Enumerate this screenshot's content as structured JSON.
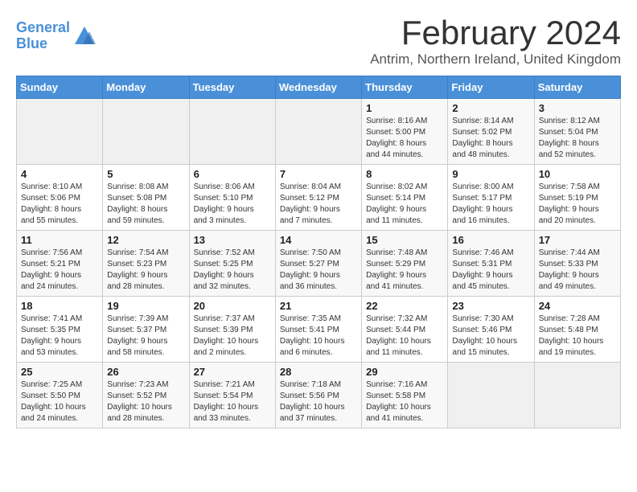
{
  "header": {
    "logo_line1": "General",
    "logo_line2": "Blue",
    "month_year": "February 2024",
    "location": "Antrim, Northern Ireland, United Kingdom"
  },
  "days_of_week": [
    "Sunday",
    "Monday",
    "Tuesday",
    "Wednesday",
    "Thursday",
    "Friday",
    "Saturday"
  ],
  "weeks": [
    [
      {
        "day": "",
        "info": ""
      },
      {
        "day": "",
        "info": ""
      },
      {
        "day": "",
        "info": ""
      },
      {
        "day": "",
        "info": ""
      },
      {
        "day": "1",
        "info": "Sunrise: 8:16 AM\nSunset: 5:00 PM\nDaylight: 8 hours\nand 44 minutes."
      },
      {
        "day": "2",
        "info": "Sunrise: 8:14 AM\nSunset: 5:02 PM\nDaylight: 8 hours\nand 48 minutes."
      },
      {
        "day": "3",
        "info": "Sunrise: 8:12 AM\nSunset: 5:04 PM\nDaylight: 8 hours\nand 52 minutes."
      }
    ],
    [
      {
        "day": "4",
        "info": "Sunrise: 8:10 AM\nSunset: 5:06 PM\nDaylight: 8 hours\nand 55 minutes."
      },
      {
        "day": "5",
        "info": "Sunrise: 8:08 AM\nSunset: 5:08 PM\nDaylight: 8 hours\nand 59 minutes."
      },
      {
        "day": "6",
        "info": "Sunrise: 8:06 AM\nSunset: 5:10 PM\nDaylight: 9 hours\nand 3 minutes."
      },
      {
        "day": "7",
        "info": "Sunrise: 8:04 AM\nSunset: 5:12 PM\nDaylight: 9 hours\nand 7 minutes."
      },
      {
        "day": "8",
        "info": "Sunrise: 8:02 AM\nSunset: 5:14 PM\nDaylight: 9 hours\nand 11 minutes."
      },
      {
        "day": "9",
        "info": "Sunrise: 8:00 AM\nSunset: 5:17 PM\nDaylight: 9 hours\nand 16 minutes."
      },
      {
        "day": "10",
        "info": "Sunrise: 7:58 AM\nSunset: 5:19 PM\nDaylight: 9 hours\nand 20 minutes."
      }
    ],
    [
      {
        "day": "11",
        "info": "Sunrise: 7:56 AM\nSunset: 5:21 PM\nDaylight: 9 hours\nand 24 minutes."
      },
      {
        "day": "12",
        "info": "Sunrise: 7:54 AM\nSunset: 5:23 PM\nDaylight: 9 hours\nand 28 minutes."
      },
      {
        "day": "13",
        "info": "Sunrise: 7:52 AM\nSunset: 5:25 PM\nDaylight: 9 hours\nand 32 minutes."
      },
      {
        "day": "14",
        "info": "Sunrise: 7:50 AM\nSunset: 5:27 PM\nDaylight: 9 hours\nand 36 minutes."
      },
      {
        "day": "15",
        "info": "Sunrise: 7:48 AM\nSunset: 5:29 PM\nDaylight: 9 hours\nand 41 minutes."
      },
      {
        "day": "16",
        "info": "Sunrise: 7:46 AM\nSunset: 5:31 PM\nDaylight: 9 hours\nand 45 minutes."
      },
      {
        "day": "17",
        "info": "Sunrise: 7:44 AM\nSunset: 5:33 PM\nDaylight: 9 hours\nand 49 minutes."
      }
    ],
    [
      {
        "day": "18",
        "info": "Sunrise: 7:41 AM\nSunset: 5:35 PM\nDaylight: 9 hours\nand 53 minutes."
      },
      {
        "day": "19",
        "info": "Sunrise: 7:39 AM\nSunset: 5:37 PM\nDaylight: 9 hours\nand 58 minutes."
      },
      {
        "day": "20",
        "info": "Sunrise: 7:37 AM\nSunset: 5:39 PM\nDaylight: 10 hours\nand 2 minutes."
      },
      {
        "day": "21",
        "info": "Sunrise: 7:35 AM\nSunset: 5:41 PM\nDaylight: 10 hours\nand 6 minutes."
      },
      {
        "day": "22",
        "info": "Sunrise: 7:32 AM\nSunset: 5:44 PM\nDaylight: 10 hours\nand 11 minutes."
      },
      {
        "day": "23",
        "info": "Sunrise: 7:30 AM\nSunset: 5:46 PM\nDaylight: 10 hours\nand 15 minutes."
      },
      {
        "day": "24",
        "info": "Sunrise: 7:28 AM\nSunset: 5:48 PM\nDaylight: 10 hours\nand 19 minutes."
      }
    ],
    [
      {
        "day": "25",
        "info": "Sunrise: 7:25 AM\nSunset: 5:50 PM\nDaylight: 10 hours\nand 24 minutes."
      },
      {
        "day": "26",
        "info": "Sunrise: 7:23 AM\nSunset: 5:52 PM\nDaylight: 10 hours\nand 28 minutes."
      },
      {
        "day": "27",
        "info": "Sunrise: 7:21 AM\nSunset: 5:54 PM\nDaylight: 10 hours\nand 33 minutes."
      },
      {
        "day": "28",
        "info": "Sunrise: 7:18 AM\nSunset: 5:56 PM\nDaylight: 10 hours\nand 37 minutes."
      },
      {
        "day": "29",
        "info": "Sunrise: 7:16 AM\nSunset: 5:58 PM\nDaylight: 10 hours\nand 41 minutes."
      },
      {
        "day": "",
        "info": ""
      },
      {
        "day": "",
        "info": ""
      }
    ]
  ]
}
